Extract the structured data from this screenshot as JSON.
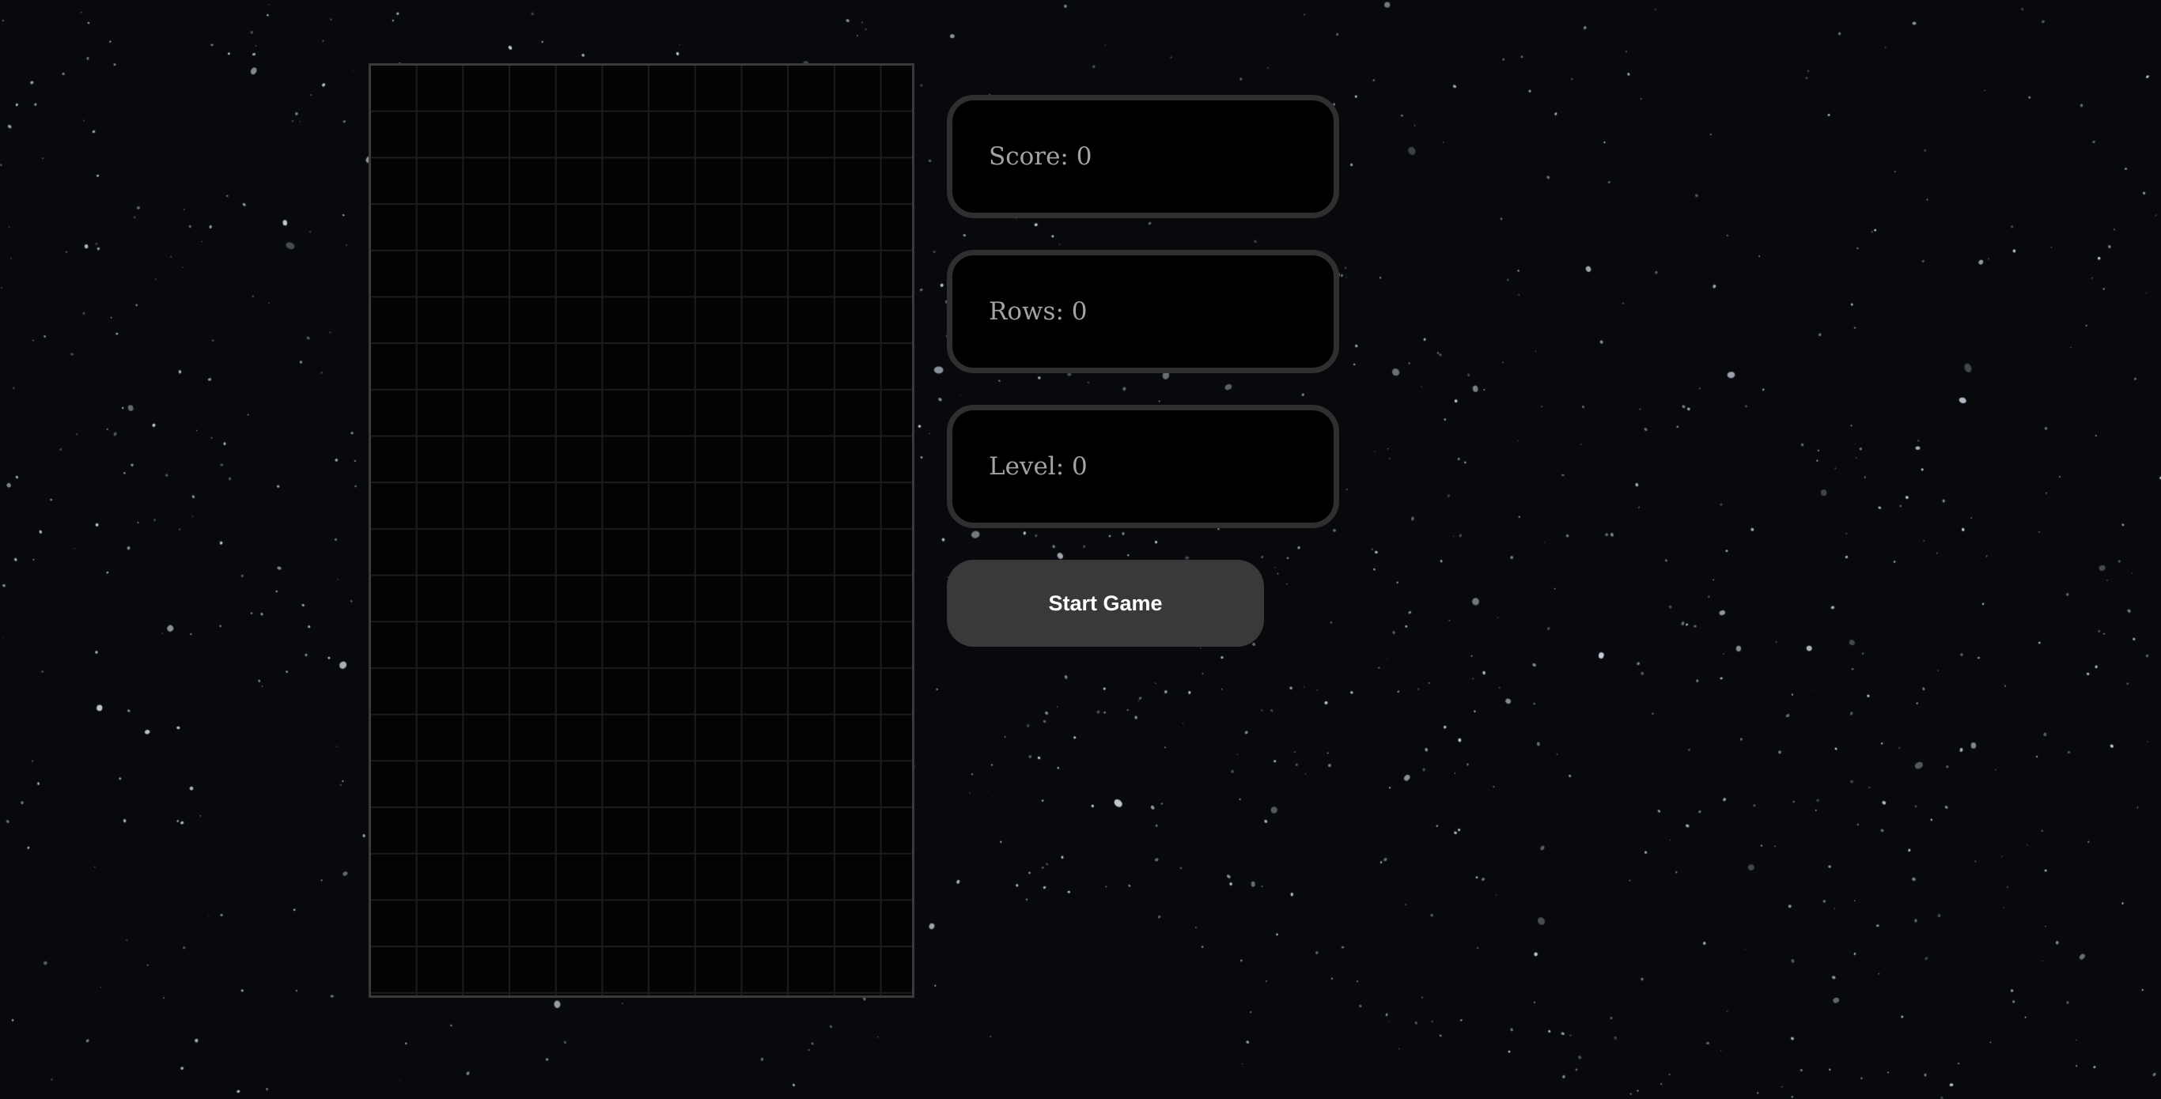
{
  "stats": {
    "score_label": "Score: 0",
    "rows_label": "Rows: 0",
    "level_label": "Level: 0"
  },
  "board": {
    "columns": 12,
    "rows": 20
  },
  "controls": {
    "start_label": "Start Game"
  },
  "colors": {
    "background": "#07090c",
    "board": "#030303",
    "panel_border": "#2f2f2f",
    "button": "#393939"
  }
}
